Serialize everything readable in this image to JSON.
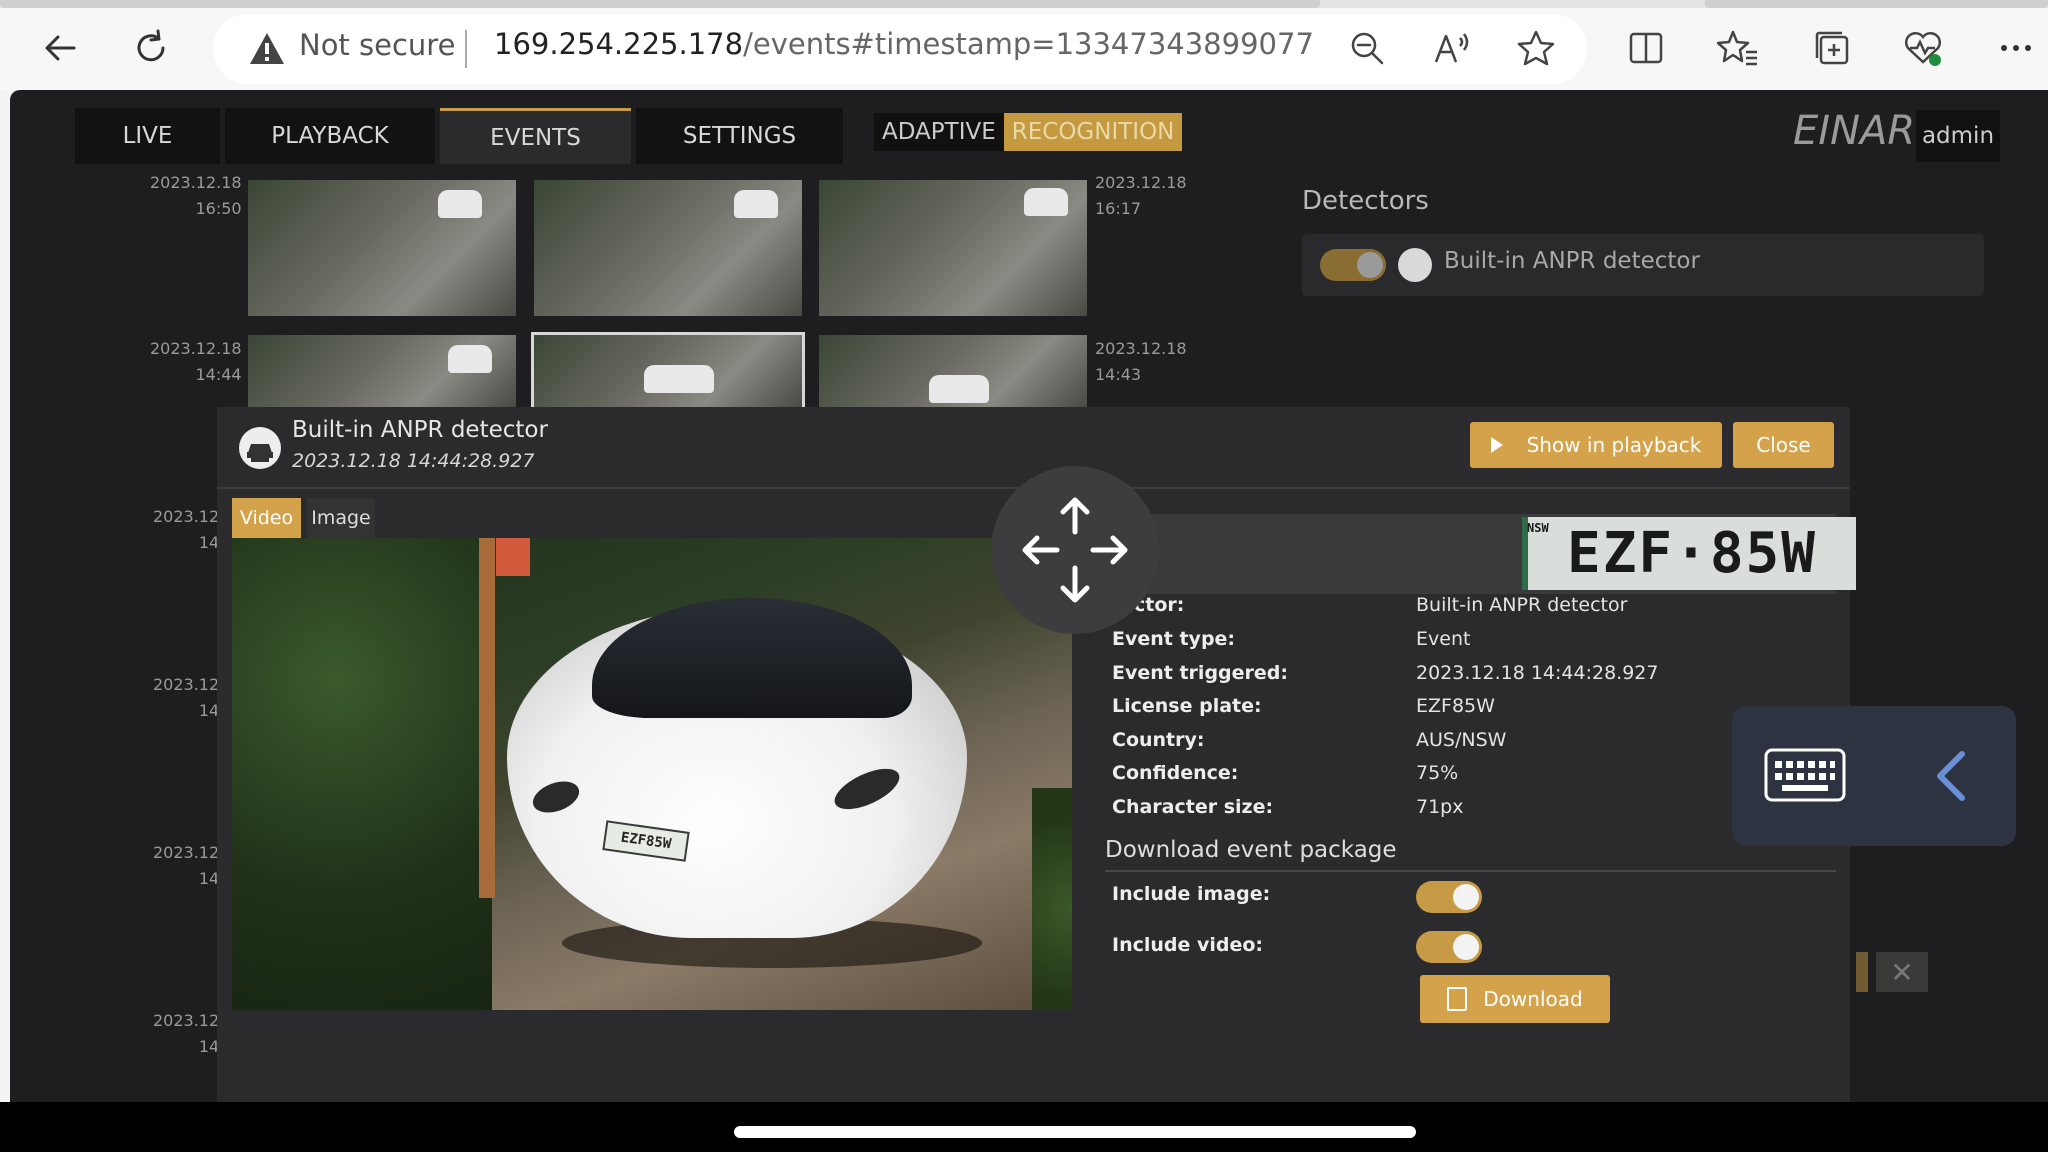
{
  "browser": {
    "security_label": "Not secure",
    "url_host": "169.254.225.178",
    "url_path": "/events#timestamp=13347343899077",
    "icons": [
      "back-icon",
      "refresh-icon",
      "warning-icon",
      "zoom-out-icon",
      "read-aloud-icon",
      "favorite-star-icon",
      "split-screen-icon",
      "favorites-icon",
      "collections-icon",
      "health-icon",
      "more-icon"
    ]
  },
  "app": {
    "nav": [
      {
        "label": "LIVE"
      },
      {
        "label": "PLAYBACK"
      },
      {
        "label": "EVENTS"
      },
      {
        "label": "SETTINGS"
      }
    ],
    "adaptive_part1": "ADAPTIVE",
    "adaptive_part2": "RECOGNITION",
    "brand": "EINAR",
    "user": "admin",
    "accent_color": "#d4a24a"
  },
  "background": {
    "timestamps": [
      {
        "date": "2023.12.18",
        "time": "16:50"
      },
      {
        "date": "2023.12.18",
        "time": "16:17"
      },
      {
        "date": "2023.12.18",
        "time": "14:44"
      },
      {
        "date": "2023.12.18",
        "time": "14:43"
      },
      {
        "date": "2023.12",
        "time": "14"
      },
      {
        "date": "2023.12",
        "time": "14"
      },
      {
        "date": "2023.12",
        "time": "14"
      },
      {
        "date": "2023.12",
        "time": "14"
      }
    ],
    "detectors_title": "Detectors",
    "detector_label": "Built-in ANPR detector"
  },
  "modal": {
    "title": "Built-in ANPR detector",
    "timestamp": "2023.12.18 14:44:28.927",
    "show_in_playback": "Show in playback",
    "close": "Close",
    "tab_video": "Video",
    "tab_image": "Image",
    "plate_image_text": "EZF·85W",
    "plate_state_text": "NSW",
    "car_plate_text": "EZF85W",
    "details": [
      {
        "key": "Detector:",
        "display_key": "tector:",
        "value": "Built-in ANPR detector"
      },
      {
        "key": "Event type:",
        "value": "Event"
      },
      {
        "key": "Event triggered:",
        "value": "2023.12.18 14:44:28.927"
      },
      {
        "key": "License plate:",
        "value": "EZF85W"
      },
      {
        "key": "Country:",
        "value": "AUS/NSW"
      },
      {
        "key": "Confidence:",
        "value": "75%"
      },
      {
        "key": "Character size:",
        "value": "71px"
      }
    ],
    "download_title": "Download event package",
    "include_image_label": "Include image:",
    "include_image": true,
    "include_video_label": "Include video:",
    "include_video": true,
    "download_button": "Download"
  },
  "overlay": {
    "move_icon": "move-arrows-icon",
    "keyboard_icon": "keyboard-icon",
    "chevron_icon": "chevron-left-icon"
  }
}
